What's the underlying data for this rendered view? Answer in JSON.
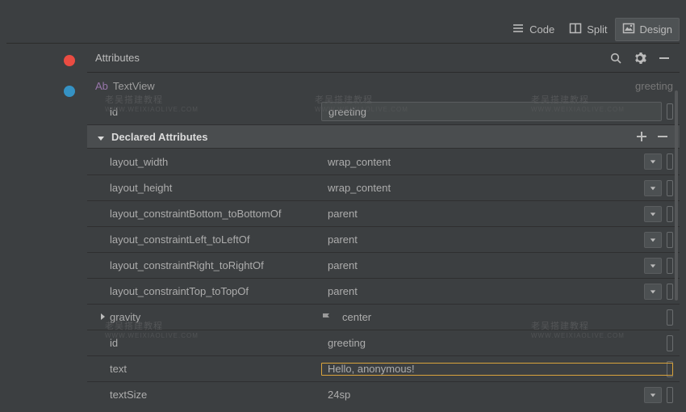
{
  "toolbar": {
    "tabs": {
      "code": "Code",
      "split": "Split",
      "design": "Design"
    }
  },
  "panel": {
    "title": "Attributes",
    "componentType": "TextView",
    "componentBadge": "Ab",
    "componentIdLabel": "greeting",
    "idRow": {
      "name": "id",
      "value": "greeting"
    },
    "section": {
      "title": "Declared Attributes"
    },
    "attrs": [
      {
        "name": "layout_width",
        "value": "wrap_content",
        "hasDropdown": true,
        "hasHandle": true
      },
      {
        "name": "layout_height",
        "value": "wrap_content",
        "hasDropdown": true,
        "hasHandle": true
      },
      {
        "name": "layout_constraintBottom_toBottomOf",
        "value": "parent",
        "hasDropdown": true,
        "hasHandle": true
      },
      {
        "name": "layout_constraintLeft_toLeftOf",
        "value": "parent",
        "hasDropdown": true,
        "hasHandle": true
      },
      {
        "name": "layout_constraintRight_toRightOf",
        "value": "parent",
        "hasDropdown": true,
        "hasHandle": true
      },
      {
        "name": "layout_constraintTop_toTopOf",
        "value": "parent",
        "hasDropdown": true,
        "hasHandle": true
      },
      {
        "name": "gravity",
        "value": "center",
        "hasDropdown": false,
        "hasHandle": true,
        "expandable": true,
        "flag": true
      },
      {
        "name": "id",
        "value": "greeting",
        "hasDropdown": false,
        "hasHandle": true
      },
      {
        "name": "text",
        "value": "Hello, anonymous!",
        "hasDropdown": false,
        "hasHandle": true,
        "highlighted": true
      },
      {
        "name": "textSize",
        "value": "24sp",
        "hasDropdown": true,
        "hasHandle": true
      }
    ]
  },
  "watermark": {
    "cn": "老吴搭建教程",
    "url": "WWW.WEIXIAOLIVE.COM"
  }
}
